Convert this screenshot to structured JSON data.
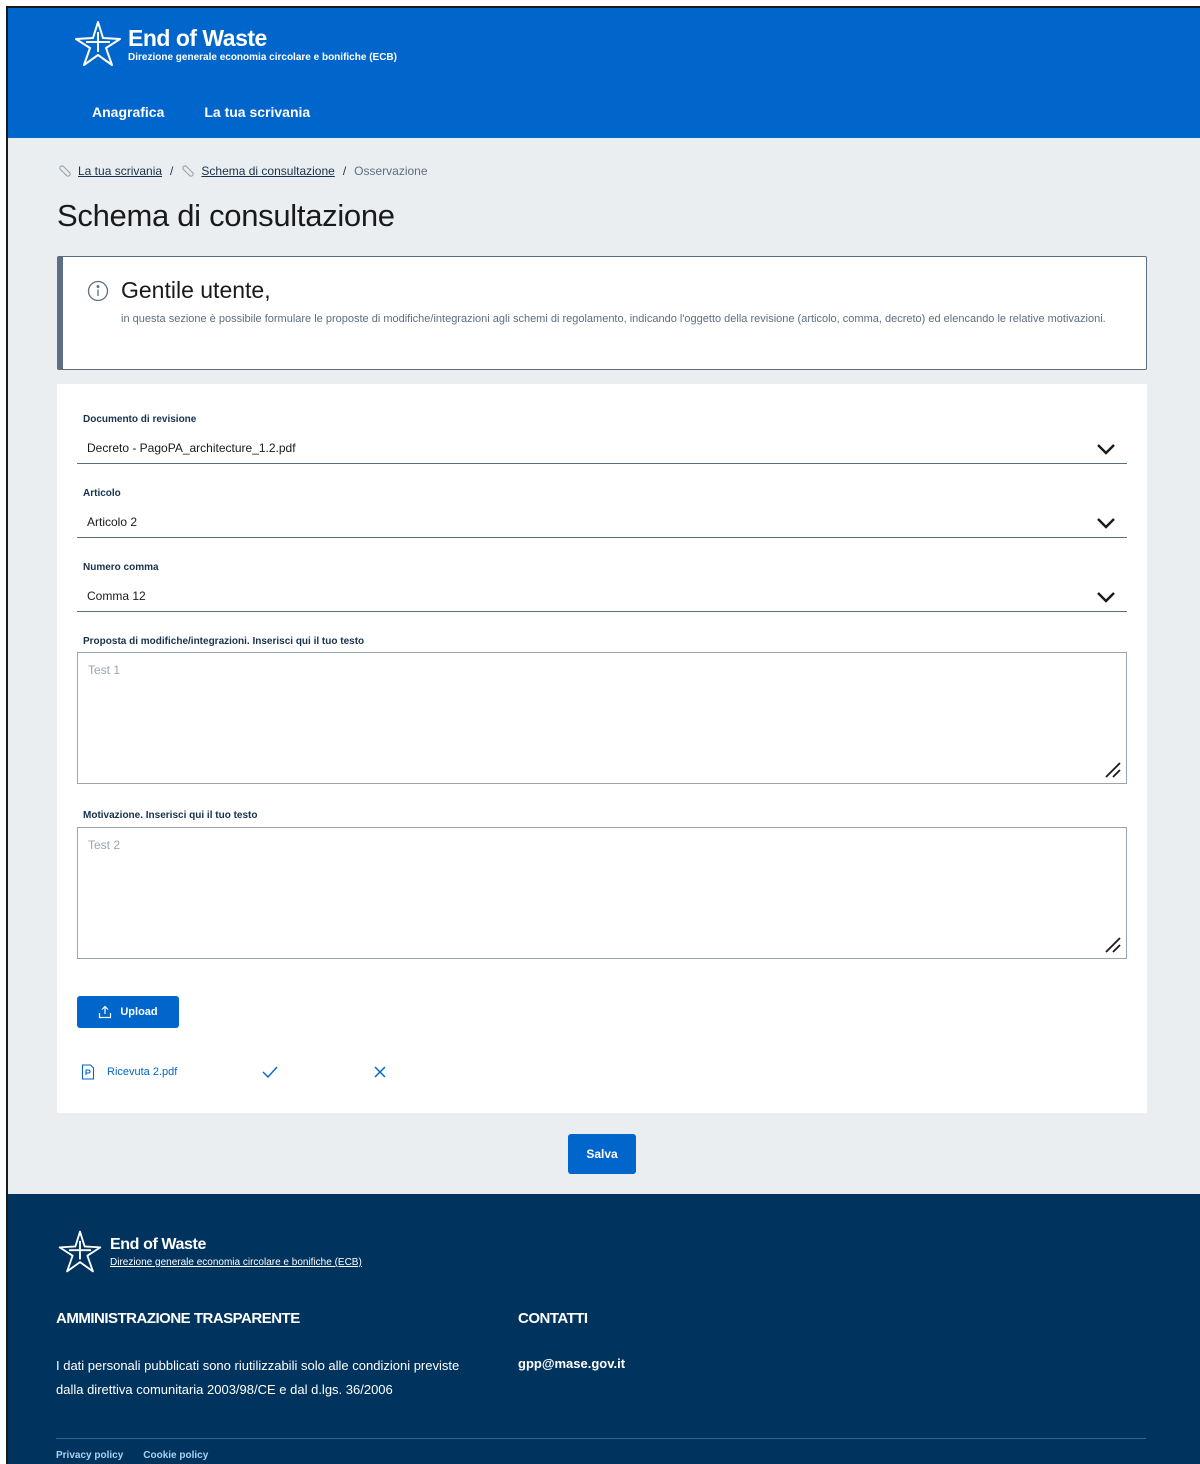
{
  "header": {
    "title": "End of Waste",
    "subtitle": "Direzione generale economia circolare e bonifiche (ECB)",
    "nav": [
      {
        "label": "Anagrafica"
      },
      {
        "label": "La tua scrivania"
      }
    ]
  },
  "breadcrumb": {
    "items": [
      {
        "label": "La tua scrivania"
      },
      {
        "label": "Schema di consultazione"
      }
    ],
    "separator": "/",
    "current": "Osservazione"
  },
  "page": {
    "title": "Schema di consultazione"
  },
  "callout": {
    "title": "Gentile utente,",
    "text": "in questa sezione è possibile formulare le proposte di modifiche/integrazioni agli schemi di regolamento, indicando l'oggetto della revisione (articolo, comma, decreto) ed elencando le relative motivazioni."
  },
  "form": {
    "documento": {
      "label": "Documento di revisione",
      "value": "Decreto - PagoPA_architecture_1.2.pdf"
    },
    "articolo": {
      "label": "Articolo",
      "value": "Articolo 2"
    },
    "comma": {
      "label": "Numero comma",
      "value": "Comma 12"
    },
    "proposta": {
      "label": "Proposta di modifiche/integrazioni. Inserisci qui il tuo testo",
      "value": "Test 1"
    },
    "motivazione": {
      "label": "Motivazione. Inserisci qui il tuo testo",
      "value": "Test 2"
    },
    "upload_label": "Upload",
    "file": {
      "name": "Ricevuta 2.pdf"
    }
  },
  "save_label": "Salva",
  "footer": {
    "title": "End of Waste",
    "subtitle": "Direzione generale economia circolare e bonifiche (ECB)",
    "admin_heading": "AMMINISTRAZIONE TRASPARENTE",
    "admin_text": "I dati personali pubblicati sono riutilizzabili solo alle condizioni previste dalla direttiva comunitaria 2003/98/CE e dal d.lgs. 36/2006",
    "contacts_heading": "CONTATTI",
    "email": "gpp@mase.gov.it",
    "links": [
      {
        "label": "Privacy policy"
      },
      {
        "label": "Cookie policy"
      }
    ]
  },
  "colors": {
    "primary": "#0066cc",
    "footer": "#00335e",
    "background": "#ebeef1"
  }
}
